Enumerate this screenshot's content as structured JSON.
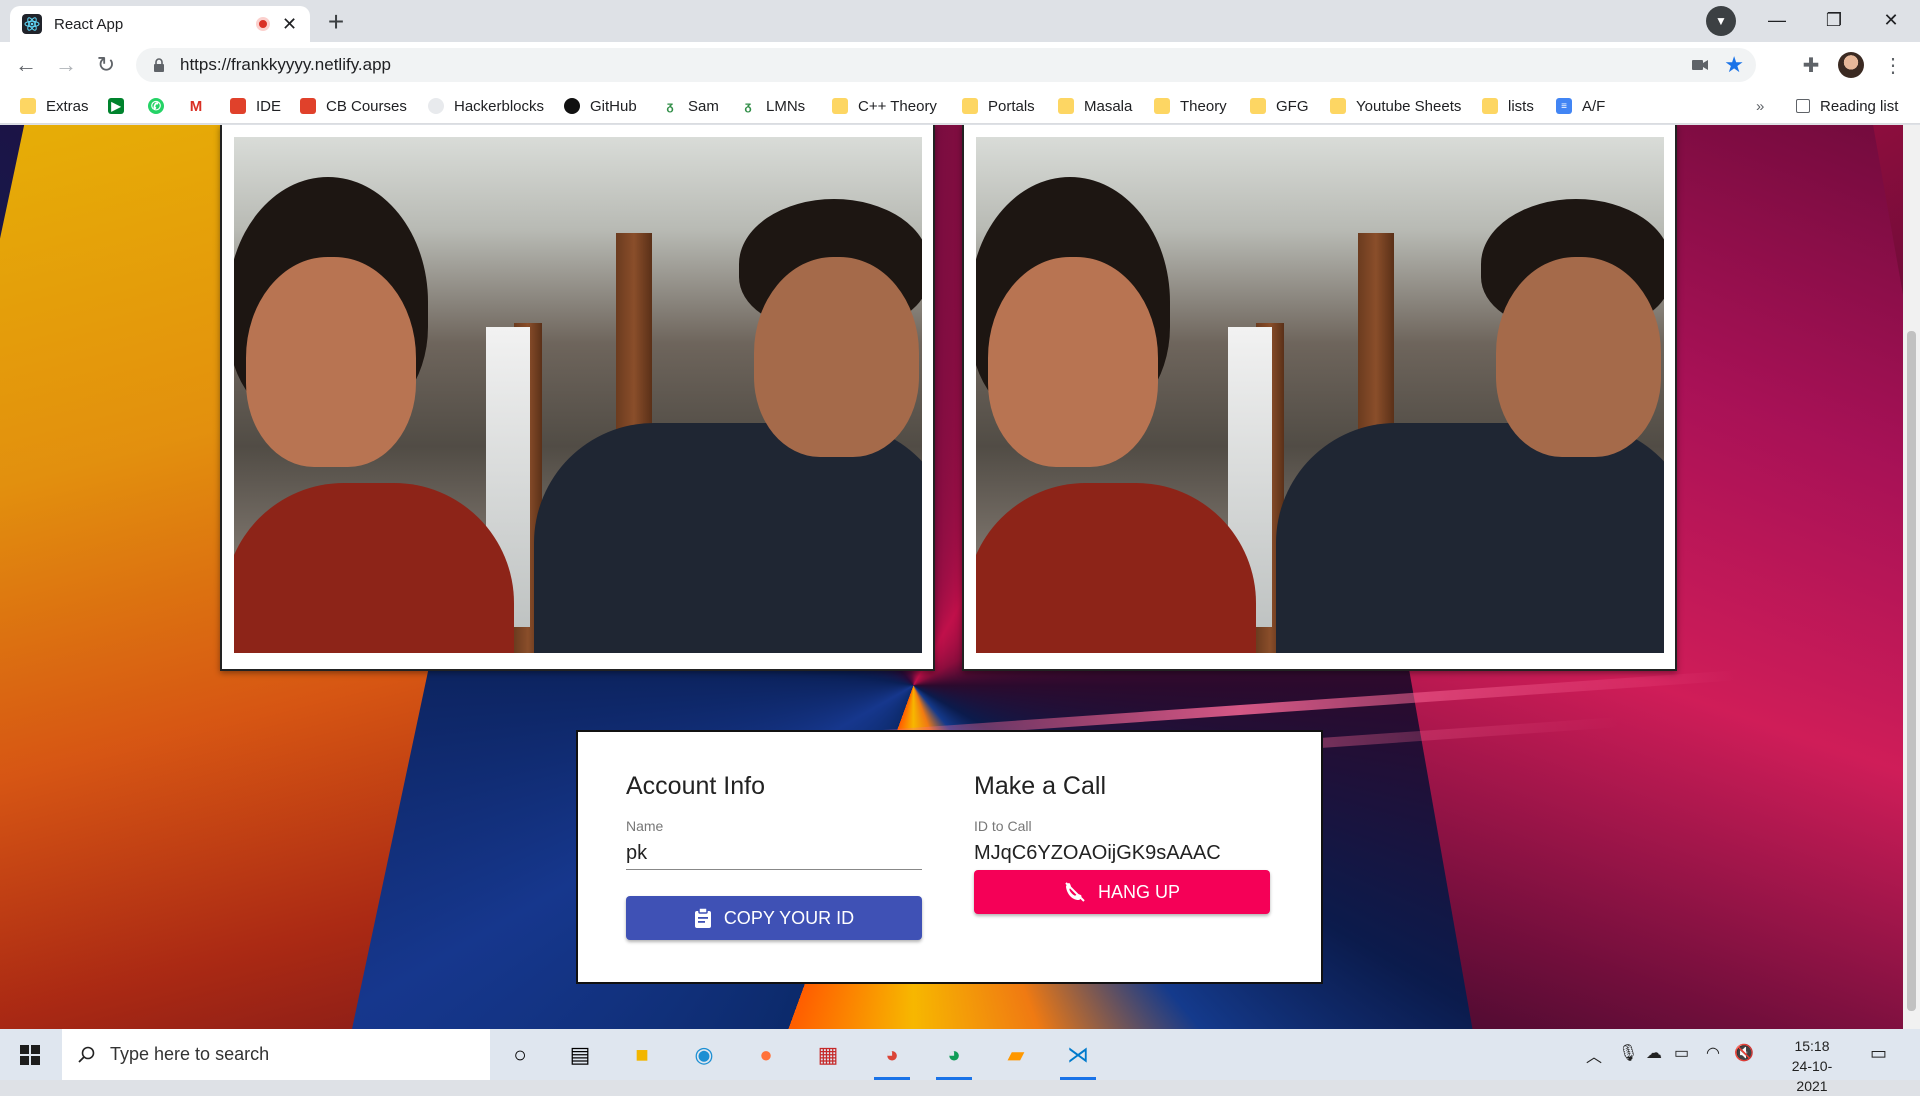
{
  "browser": {
    "tab_title": "React App",
    "url": "https://frankkyyyy.netlify.app",
    "bookmarks": [
      {
        "label": "Extras",
        "icon": "folder-icon"
      },
      {
        "label": "",
        "icon": "meet-icon"
      },
      {
        "label": "",
        "icon": "whatsapp-icon"
      },
      {
        "label": "",
        "icon": "gmail-icon"
      },
      {
        "label": "IDE",
        "icon": "ide-icon"
      },
      {
        "label": "CB Courses",
        "icon": "cb-icon"
      },
      {
        "label": "Hackerblocks",
        "icon": "hackerblocks-icon"
      },
      {
        "label": "GitHub",
        "icon": "github-icon"
      },
      {
        "label": "Sam",
        "icon": "gfg-icon"
      },
      {
        "label": "LMNs",
        "icon": "gfg-icon"
      },
      {
        "label": "C++ Theory",
        "icon": "folder-icon"
      },
      {
        "label": "Portals",
        "icon": "folder-icon"
      },
      {
        "label": "Masala",
        "icon": "folder-icon"
      },
      {
        "label": "Theory",
        "icon": "folder-icon"
      },
      {
        "label": "GFG",
        "icon": "folder-icon"
      },
      {
        "label": "Youtube Sheets",
        "icon": "folder-icon"
      },
      {
        "label": "lists",
        "icon": "folder-icon"
      },
      {
        "label": "A/F",
        "icon": "docs-icon"
      }
    ],
    "more_bookmarks": "»",
    "reading_list": "Reading list"
  },
  "app": {
    "account": {
      "heading": "Account Info",
      "name_label": "Name",
      "name_value": "pk",
      "copy_button": "COPY YOUR ID"
    },
    "call": {
      "heading": "Make a Call",
      "id_label": "ID to Call",
      "id_value": "MJqC6YZOAOijGK9sAAAC",
      "hangup_button": "HANG UP"
    }
  },
  "taskbar": {
    "search_placeholder": "Type here to search",
    "time": "15:18",
    "date": "24-10-2021"
  }
}
